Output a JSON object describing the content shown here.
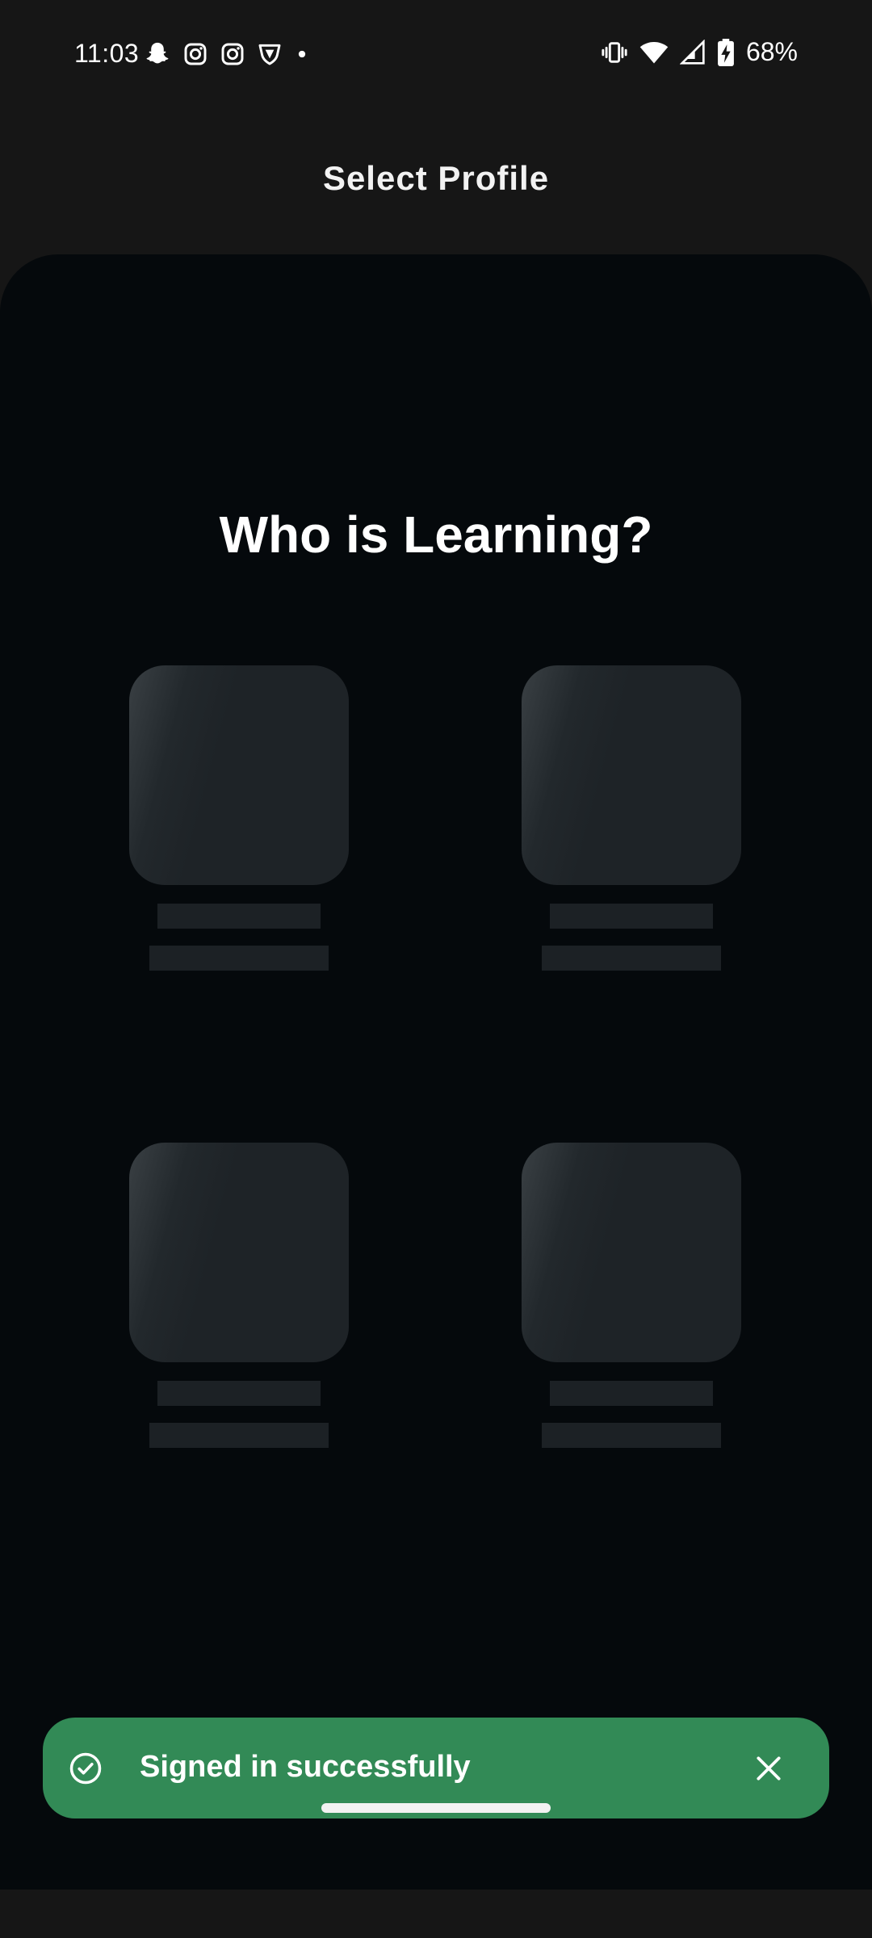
{
  "status_bar": {
    "time": "11:03",
    "left_icons": [
      "snapchat-icon",
      "instagram-icon",
      "instagram-icon",
      "vpn-icon",
      "dot-icon"
    ],
    "right_icons": [
      "vibrate-icon",
      "wifi-icon",
      "signal-icon",
      "battery-charging-icon"
    ],
    "battery": "68%"
  },
  "app_bar": {
    "title": "Select Profile"
  },
  "main": {
    "heading": "Who is Learning?",
    "profiles_loading": 4
  },
  "snackbar": {
    "message": "Signed in successfully",
    "color": "#328a56",
    "icon": "check-circle-icon",
    "close_icon": "close-icon"
  },
  "colors": {
    "background": "#161616",
    "sheet": "#05090c",
    "skeleton": "#1e2327"
  }
}
